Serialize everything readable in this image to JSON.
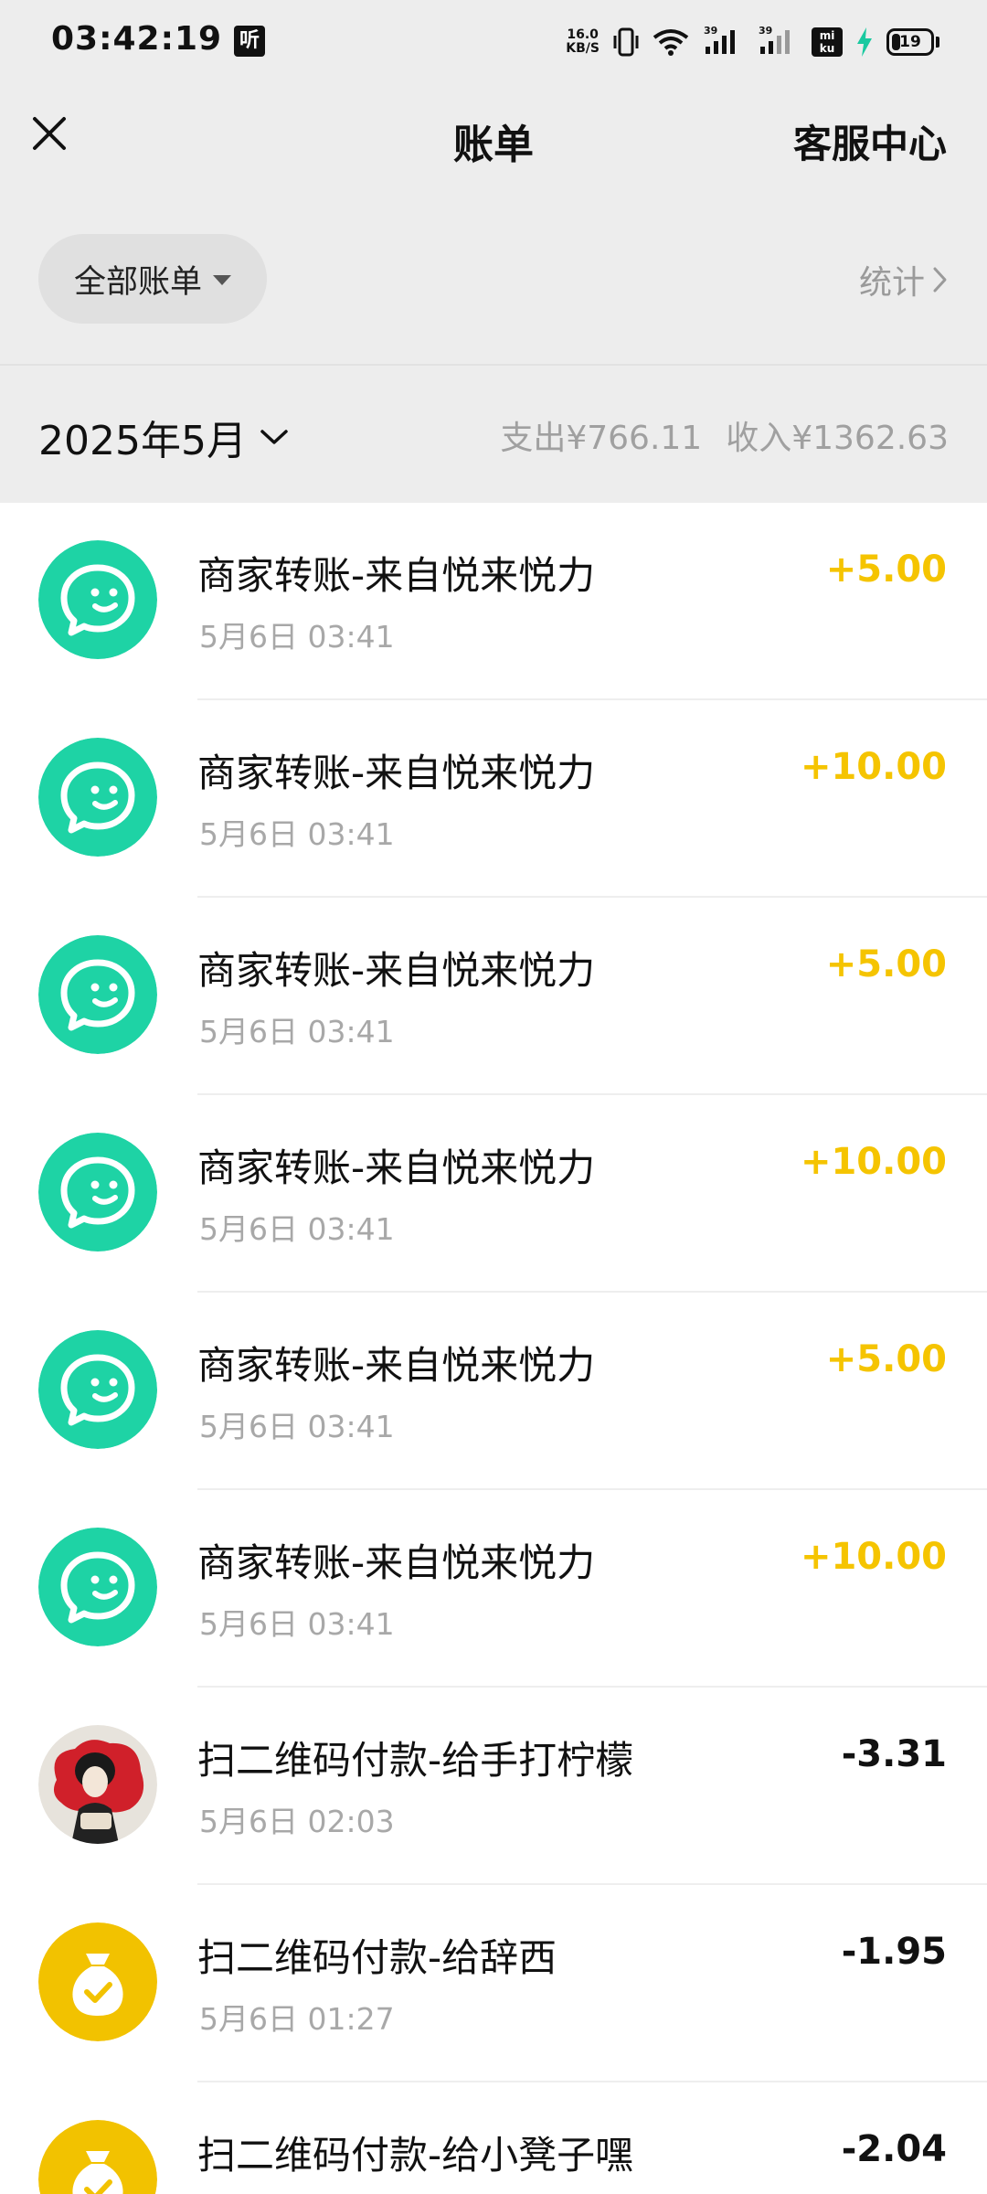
{
  "status_bar": {
    "time": "03:42:19",
    "app_badge": "听",
    "net_speed_value": "16.0",
    "net_speed_unit": "KB/S",
    "sim1": "39",
    "sim2": "39",
    "sim_card": "mi ku",
    "battery": "19",
    "battery_level": 0.19
  },
  "header": {
    "title": "账单",
    "service": "客服中心"
  },
  "filter": {
    "label": "全部账单",
    "stats": "统计"
  },
  "month": {
    "label": "2025年5月",
    "expense": "支出¥766.11",
    "income": "收入¥1362.63"
  },
  "colors": {
    "wechat_green": "#1ed3a5",
    "income_yellow": "#f5c400",
    "money_bag_yellow": "#f2c200"
  },
  "bills": [
    {
      "title": "商家转账-来自悦来悦力",
      "time": "5月6日 03:41",
      "amount": "+5.00",
      "icon": "wechat-bubble-icon",
      "kind": "income"
    },
    {
      "title": "商家转账-来自悦来悦力",
      "time": "5月6日 03:41",
      "amount": "+10.00",
      "icon": "wechat-bubble-icon",
      "kind": "income"
    },
    {
      "title": "商家转账-来自悦来悦力",
      "time": "5月6日 03:41",
      "amount": "+5.00",
      "icon": "wechat-bubble-icon",
      "kind": "income"
    },
    {
      "title": "商家转账-来自悦来悦力",
      "time": "5月6日 03:41",
      "amount": "+10.00",
      "icon": "wechat-bubble-icon",
      "kind": "income"
    },
    {
      "title": "商家转账-来自悦来悦力",
      "time": "5月6日 03:41",
      "amount": "+5.00",
      "icon": "wechat-bubble-icon",
      "kind": "income"
    },
    {
      "title": "商家转账-来自悦来悦力",
      "time": "5月6日 03:41",
      "amount": "+10.00",
      "icon": "wechat-bubble-icon",
      "kind": "income"
    },
    {
      "title": "扫二维码付款-给手打柠檬",
      "time": "5月6日 02:03",
      "amount": "-3.31",
      "icon": "merchant-avatar-icon",
      "kind": "expense"
    },
    {
      "title": "扫二维码付款-给辞西",
      "time": "5月6日 01:27",
      "amount": "-1.95",
      "icon": "money-bag-icon",
      "kind": "expense"
    },
    {
      "title": "扫二维码付款-给小凳子嘿",
      "time": "",
      "amount": "-2.04",
      "icon": "money-bag-icon",
      "kind": "expense"
    }
  ]
}
